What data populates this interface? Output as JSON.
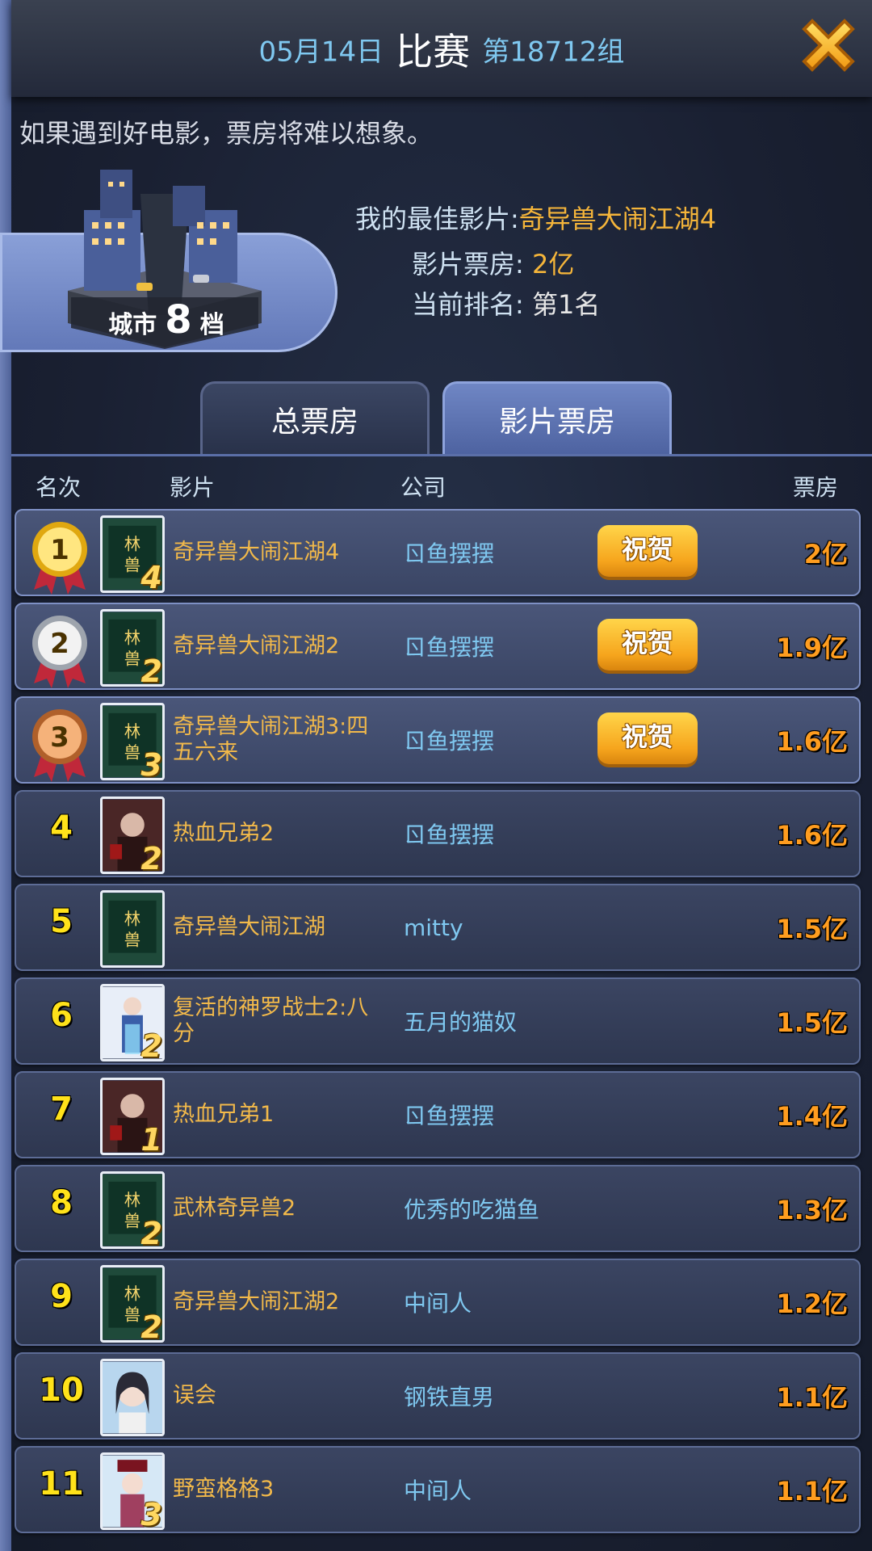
{
  "header": {
    "date": "05月14日",
    "title": "比赛",
    "group": "第18712组"
  },
  "slogan": "如果遇到好电影，票房将难以想象。",
  "city": {
    "prefix": "城市",
    "level": "8",
    "suffix": "档"
  },
  "best": {
    "film_label": "我的最佳影片:",
    "film_value": "奇异兽大闹江湖4",
    "box_label": "影片票房:",
    "box_value": "2亿",
    "rank_label": "当前排名:",
    "rank_value": "第1名"
  },
  "tabs": [
    {
      "label": "总票房",
      "active": false
    },
    {
      "label": "影片票房",
      "active": true
    }
  ],
  "columns": {
    "rank": "名次",
    "film": "影片",
    "company": "公司",
    "box": "票房"
  },
  "cheer_label": "祝贺",
  "rows": [
    {
      "rank": "1",
      "film": "奇异兽大闹江湖4",
      "company": "ㄖ鱼摆摆",
      "box": "2亿",
      "seq": "4",
      "poster": "green"
    },
    {
      "rank": "2",
      "film": "奇异兽大闹江湖2",
      "company": "ㄖ鱼摆摆",
      "box": "1.9亿",
      "seq": "2",
      "poster": "green"
    },
    {
      "rank": "3",
      "film": "奇异兽大闹江湖3:四五六来",
      "company": "ㄖ鱼摆摆",
      "box": "1.6亿",
      "seq": "3",
      "poster": "green"
    },
    {
      "rank": "4",
      "film": "热血兄弟2",
      "company": "ㄖ鱼摆摆",
      "box": "1.6亿",
      "seq": "2",
      "poster": "red"
    },
    {
      "rank": "5",
      "film": "奇异兽大闹江湖",
      "company": "mitty",
      "box": "1.5亿",
      "seq": "",
      "poster": "green"
    },
    {
      "rank": "6",
      "film": "复活的神罗战士2:八分",
      "company": "五月的猫奴",
      "box": "1.5亿",
      "seq": "2",
      "poster": "blue"
    },
    {
      "rank": "7",
      "film": "热血兄弟1",
      "company": "ㄖ鱼摆摆",
      "box": "1.4亿",
      "seq": "1",
      "poster": "red"
    },
    {
      "rank": "8",
      "film": "武林奇异兽2",
      "company": "优秀的吃猫鱼",
      "box": "1.3亿",
      "seq": "2",
      "poster": "green"
    },
    {
      "rank": "9",
      "film": "奇异兽大闹江湖2",
      "company": "中间人",
      "box": "1.2亿",
      "seq": "2",
      "poster": "green"
    },
    {
      "rank": "10",
      "film": "误会",
      "company": "钢铁直男",
      "box": "1.1亿",
      "seq": "",
      "poster": "portrait"
    },
    {
      "rank": "11",
      "film": "野蛮格格3",
      "company": "中间人",
      "box": "1.1亿",
      "seq": "3",
      "poster": "princess"
    }
  ],
  "colors": {
    "accent_blue": "#7fc8f0",
    "film_orange": "#f2b94a",
    "box_orange": "#ff9d1f",
    "rank_yellow": "#ffe21a"
  }
}
